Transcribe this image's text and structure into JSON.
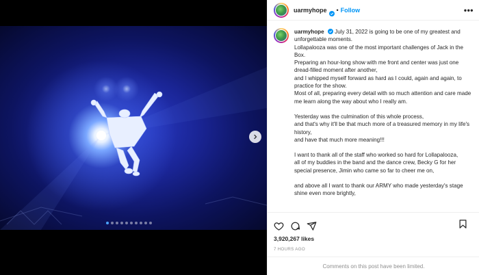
{
  "post": {
    "username": "uarmyhope",
    "follow_label": "Follow",
    "separator": "•",
    "more_label": "•••",
    "caption_lines": [
      "July 31, 2022 is going to be one of my greatest and unforgettable moments.",
      "Lollapalooza was one of the most important challenges of Jack in the Box.",
      "Preparing an hour-long show with me front and center was just one dread-filled moment after another,",
      "and I whipped myself forward as hard as I could, again and again, to practice for the show.",
      "Most of all, preparing every detail with so much attention and care made me learn along the way about who I really am.",
      "",
      "Yesterday was the culmination of this whole process,",
      "and that's why it'll be that much more of a treasured memory in my life's history,",
      "and have that much more meaning!!!",
      "",
      "I want to thank all of the staff who worked so hard for Lollapalooza,",
      "all of my buddies in the band and the dance crew, Becky G for her special presence, Jimin who came so far to cheer me on,",
      "",
      "and above all I want to thank our ARMY who made yesterday's stage shine even more brightly,"
    ],
    "likes": "3,920,267 likes",
    "timestamp": "7 HOURS AGO",
    "comments_notice": "Comments on this post have been limited."
  },
  "media": {
    "slide_count": 10,
    "active_slide": 1
  },
  "colors": {
    "accent": "#0095f6",
    "text": "#262626",
    "muted": "#8e8e8e"
  },
  "icons": [
    "verified-badge-icon",
    "more-options-icon",
    "heart-icon",
    "comment-icon",
    "share-icon",
    "bookmark-icon",
    "chevron-right-icon"
  ]
}
